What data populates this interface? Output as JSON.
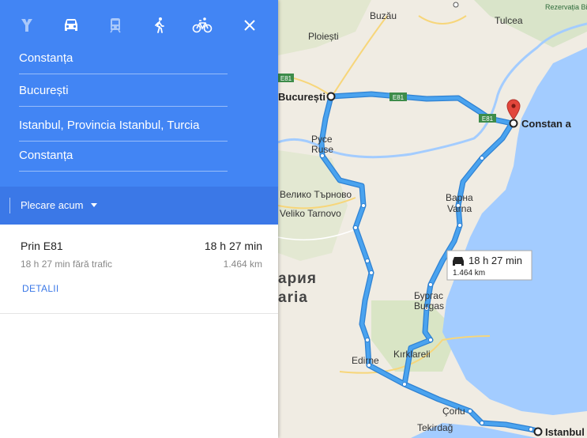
{
  "modes": [
    {
      "icon": "best-route-icon",
      "active": false
    },
    {
      "icon": "car-icon",
      "active": true
    },
    {
      "icon": "train-icon",
      "active": false
    },
    {
      "icon": "walk-icon",
      "active": false
    },
    {
      "icon": "bike-icon",
      "active": false
    }
  ],
  "close_icon": "close-icon",
  "waypoints": [
    "Constanța",
    "București",
    "Istanbul, Provincia Istanbul, Turcia",
    "Constanța"
  ],
  "depart": {
    "label": "Plecare acum"
  },
  "route": {
    "name": "Prin E81",
    "time": "18 h 27 min",
    "subtitle": "18 h 27 min fără trafic",
    "distance": "1.464 km",
    "details": "DETALII"
  },
  "map": {
    "callout_time": "18 h 27 min",
    "callout_distance": "1.464 km",
    "labels": {
      "buzau": "Buzău",
      "galati_region": "Rezervația Biosferei Delta Dunării",
      "tulcea": "Tulcea",
      "ploiesti": "Ploiești",
      "bucuresti": "București",
      "constanta": "Constan a",
      "ruse_cyr": "Русе",
      "ruse": "Ruse",
      "veliko_cyr": "Велико Търново",
      "veliko": "Veliko Tarnovo",
      "varna_cyr": "Варна",
      "varna": "Varna",
      "bulgaria": "ария",
      "bulgaria2": "aria",
      "burgas_cyr": "Бургас",
      "burgas": "Burgas",
      "kirklareli": "Kırklareli",
      "edirne": "Edirne",
      "corlu": "Çorlu",
      "tekirdag": "Tekirdağ",
      "istanbul": "Istanbul",
      "e81a": "E81",
      "e81b": "E81",
      "e81c": "E81"
    },
    "colors": {
      "water": "#a3ccff",
      "land": "#f2efe9",
      "route": "#4aa3ef",
      "route_edge": "#2f82d3",
      "pin": "#e2463b"
    }
  }
}
